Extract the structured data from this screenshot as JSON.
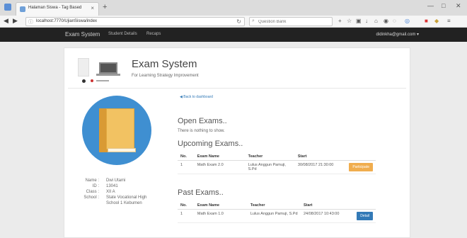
{
  "browser": {
    "tab_title": "Halaman Siswa - Tag Based",
    "tab_close": "×",
    "new_tab": "+",
    "url": "localhost:7770/UjianSiswa/index",
    "search_placeholder": "Question Bank",
    "window_controls": [
      "—",
      "□",
      "✕"
    ]
  },
  "navbar": {
    "brand": "Exam System",
    "links": [
      "Student Details",
      "Recaps"
    ],
    "user": "didinkha@gmail.com ▾"
  },
  "header": {
    "title": "Exam System",
    "tagline": "For Learning Strategy Improvement"
  },
  "profile": {
    "labels": [
      "Name :",
      "ID :",
      "Class :",
      "School :"
    ],
    "values": [
      "Dwi Utami",
      "13041",
      "XII A",
      "State Vocational High School 1 Kebumen"
    ]
  },
  "back_link": "◀ Back to dashboard",
  "open_exams": {
    "heading": "Open Exams..",
    "empty_text": "There is nothing to show."
  },
  "upcoming": {
    "heading": "Upcoming Exams..",
    "columns": [
      "No.",
      "Exam Name",
      "Teacher",
      "Start"
    ],
    "rows": [
      {
        "no": "1",
        "exam": "Math Exam 2.0",
        "teacher": "Lulus Anggun Pamuji, S.Pd",
        "start": "30/08/2017 21:30:00",
        "action": "Participate"
      }
    ]
  },
  "past": {
    "heading": "Past Exams..",
    "columns": [
      "No.",
      "Exam Name",
      "Teacher",
      "Start"
    ],
    "rows": [
      {
        "no": "1",
        "exam": "Math Exam 1.0",
        "teacher": "Lulus Anggun Pamuji, S.Pd",
        "start": "24/08/2017 10:43:00",
        "action": "Detail"
      }
    ]
  }
}
